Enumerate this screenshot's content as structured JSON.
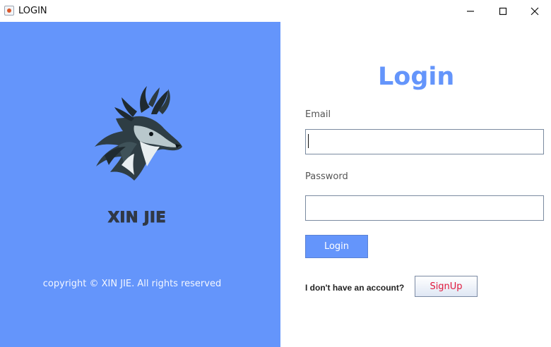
{
  "window": {
    "title": "LOGIN",
    "controls": [
      "minimize",
      "maximize",
      "close"
    ]
  },
  "brand": {
    "name": "XIN JIE",
    "copyright": "copyright © XIN JIE. All rights reserved",
    "panel_color": "#6495fb"
  },
  "form": {
    "title": "Login",
    "email_label": "Email",
    "email_value": "",
    "password_label": "Password",
    "password_value": "",
    "login_button": "Login",
    "no_account_text": "I don't have an account?",
    "signup_button": "SignUp",
    "accent_color": "#6495fb",
    "signup_text_color": "#e0183c"
  },
  "icons": {
    "app": "java-app-icon",
    "logo": "deer-head-logo-icon"
  }
}
